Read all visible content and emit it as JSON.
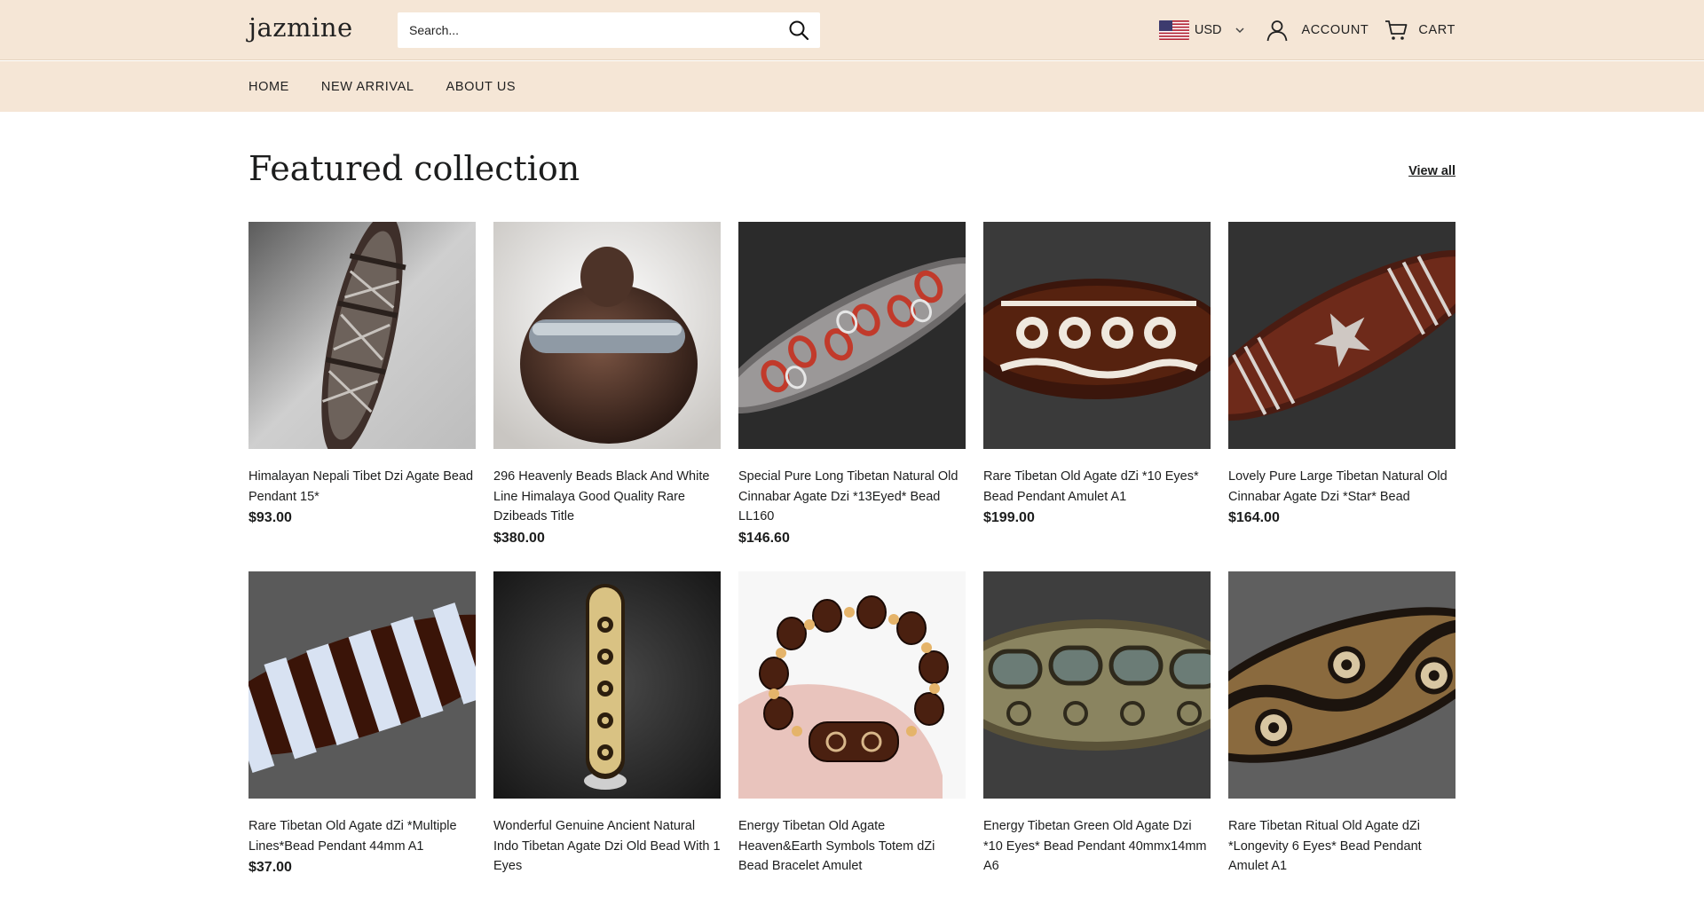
{
  "header": {
    "logo": "jazmine",
    "search_placeholder": "Search...",
    "currency": "USD",
    "account_label": "ACCOUNT",
    "cart_label": "CART"
  },
  "nav": {
    "items": [
      {
        "label": "HOME"
      },
      {
        "label": "NEW ARRIVAL"
      },
      {
        "label": "ABOUT US"
      }
    ]
  },
  "collection": {
    "title": "Featured collection",
    "view_all": "View all",
    "products": [
      {
        "title": "Himalayan Nepali Tibet Dzi Agate Bead Pendant 15*",
        "price": "$93.00"
      },
      {
        "title": "296 Heavenly Beads Black And White Line Himalaya Good Quality Rare Dzibeads Title",
        "price": "$380.00"
      },
      {
        "title": "Special Pure Long Tibetan Natural Old Cinnabar Agate Dzi *13Eyed* Bead LL160",
        "price": "$146.60"
      },
      {
        "title": "Rare Tibetan Old Agate dZi *10 Eyes* Bead Pendant Amulet A1",
        "price": "$199.00"
      },
      {
        "title": "Lovely Pure Large Tibetan Natural Old Cinnabar Agate Dzi *Star* Bead",
        "price": "$164.00"
      },
      {
        "title": "Rare Tibetan Old Agate dZi *Multiple Lines*Bead Pendant 44mm A1",
        "price": "$37.00"
      },
      {
        "title": "Wonderful Genuine Ancient Natural Indo Tibetan Agate Dzi Old Bead With 1 Eyes",
        "price": ""
      },
      {
        "title": "Energy Tibetan Old Agate Heaven&Earth Symbols Totem dZi Bead Bracelet Amulet",
        "price": ""
      },
      {
        "title": "Energy Tibetan Green Old Agate Dzi *10 Eyes* Bead Pendant 40mmx14mm A6",
        "price": ""
      },
      {
        "title": "Rare Tibetan Ritual Old Agate dZi *Longevity 6 Eyes* Bead Pendant Amulet A1",
        "price": ""
      }
    ]
  },
  "colors": {
    "header_bg": "#f5e6d6",
    "text": "#1c1d1d"
  }
}
